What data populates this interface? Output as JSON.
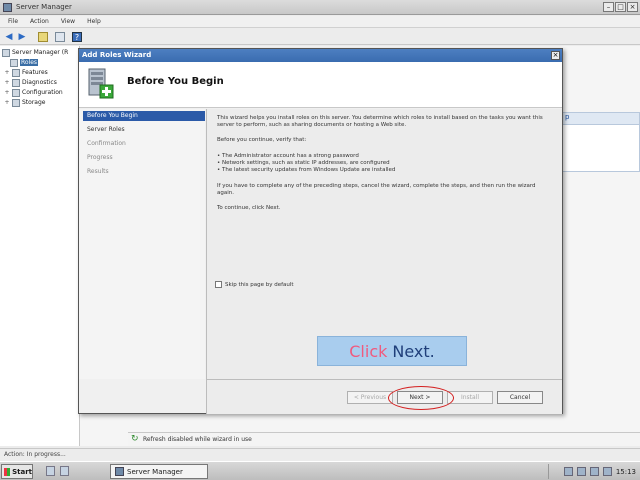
{
  "server_manager": {
    "title": "Server Manager",
    "menu": [
      "File",
      "Action",
      "View",
      "Help"
    ],
    "tree": {
      "root": "Server Manager (R",
      "items": [
        "Roles",
        "Features",
        "Diagnostics",
        "Configuration",
        "Storage"
      ]
    },
    "right_panel_header": "p",
    "refresh_text": "Refresh disabled while wizard in use",
    "status_text": "Action: In progress..."
  },
  "taskbar": {
    "start_label": "Start",
    "task_label": "Server Manager",
    "clock": "15:13"
  },
  "wizard": {
    "title": "Add Roles Wizard",
    "header_title": "Before You Begin",
    "steps": [
      {
        "label": "Before You Begin",
        "state": "active"
      },
      {
        "label": "Server Roles",
        "state": "normal"
      },
      {
        "label": "Confirmation",
        "state": "dim"
      },
      {
        "label": "Progress",
        "state": "dim"
      },
      {
        "label": "Results",
        "state": "dim"
      }
    ],
    "body": {
      "intro": "This wizard helps you install roles on this server. You determine which roles to install based on the tasks you want this server to perform, such as sharing documents or hosting a Web site.",
      "verify_heading": "Before you continue, verify that:",
      "bullets": [
        "The Administrator account has a strong password",
        "Network settings, such as static IP addresses, are configured",
        "The latest security updates from Windows Update are installed"
      ],
      "note": "If you have to complete any of the preceding steps, cancel the wizard, complete the steps, and then run the wizard again.",
      "continue_text": "To continue, click Next.",
      "skip_checkbox": "Skip this page by default"
    },
    "callout": {
      "word1": "Click",
      "word2": "Next."
    },
    "buttons": {
      "previous": "< Previous",
      "next": "Next >",
      "install": "Install",
      "cancel": "Cancel"
    }
  },
  "colors": {
    "wizard_title_bar": "#3a6cb0",
    "active_step": "#2b5aa8",
    "callout_bg": "#a9cdee",
    "callout_click": "#f05a7e",
    "callout_next": "#1f3f7a",
    "highlight_oval": "#d42020"
  }
}
